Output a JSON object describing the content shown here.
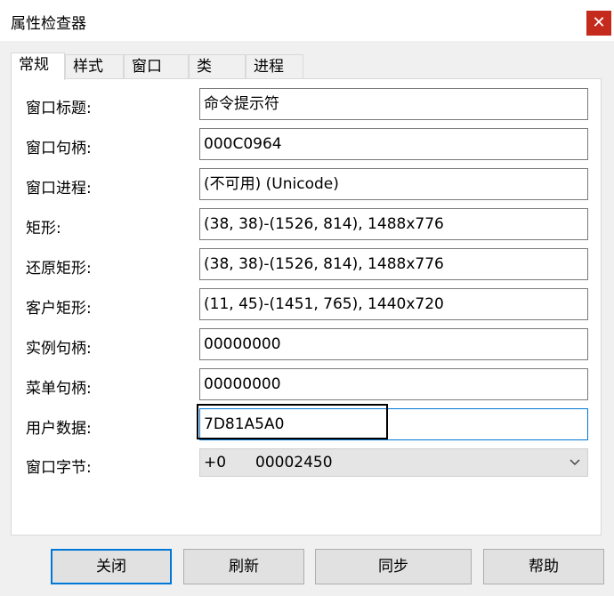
{
  "window": {
    "title": "属性检查器",
    "close_glyph": "✕"
  },
  "tabs": [
    {
      "label": "常规",
      "active": true
    },
    {
      "label": "样式"
    },
    {
      "label": "窗口"
    },
    {
      "label": "类"
    },
    {
      "label": "进程"
    }
  ],
  "fields": {
    "window_title": {
      "label": "窗口标题:",
      "value": "命令提示符"
    },
    "window_handle": {
      "label": "窗口句柄:",
      "value": "000C0964"
    },
    "window_process": {
      "label": "窗口进程:",
      "value": "(不可用) (Unicode)"
    },
    "rect": {
      "label": "矩形:",
      "value": "(38, 38)-(1526, 814), 1488x776"
    },
    "restored_rect": {
      "label": "还原矩形:",
      "value": "(38, 38)-(1526, 814), 1488x776"
    },
    "client_rect": {
      "label": "客户矩形:",
      "value": "(11, 45)-(1451, 765), 1440x720"
    },
    "instance_handle": {
      "label": "实例句柄:",
      "value": "00000000"
    },
    "menu_handle": {
      "label": "菜单句柄:",
      "value": "00000000"
    },
    "user_data": {
      "label": "用户数据:",
      "value": "7D81A5A0"
    },
    "window_bytes": {
      "label": "窗口字节:",
      "offset": "+0",
      "value": "00002450"
    }
  },
  "buttons": {
    "close": "关闭",
    "refresh": "刷新",
    "sync": "同步",
    "help": "帮助"
  },
  "colors": {
    "accent": "#0078d7",
    "close_bg": "#c42b1c"
  }
}
